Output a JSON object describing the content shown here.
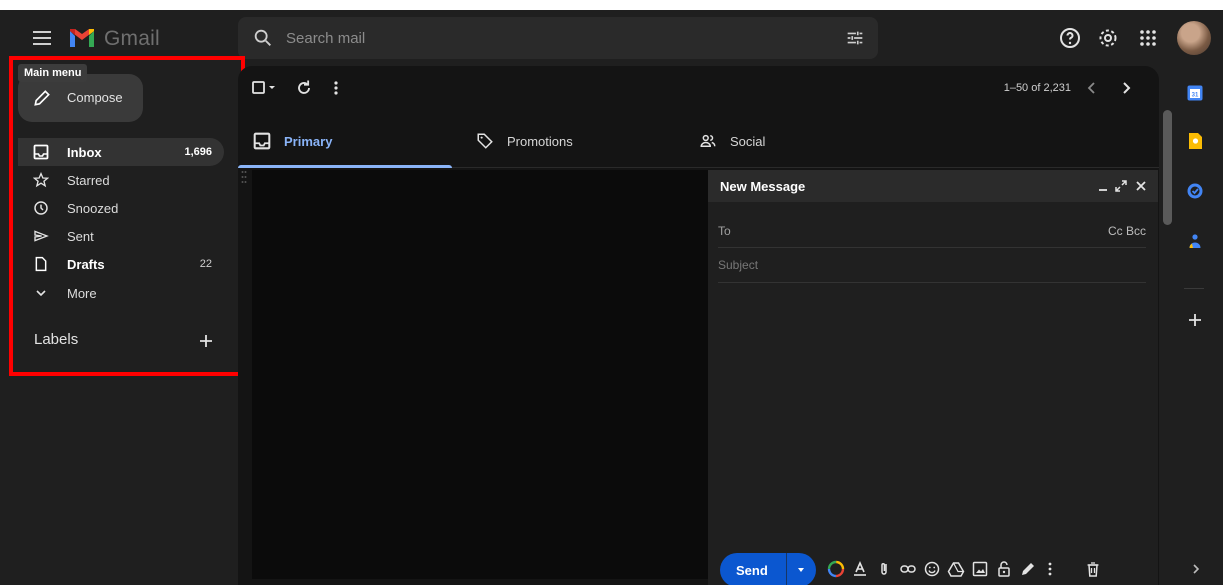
{
  "header": {
    "app_name": "Gmail",
    "search_placeholder": "Search mail"
  },
  "sidebar": {
    "tooltip": "Main menu",
    "compose_label": "Compose",
    "items": [
      {
        "label": "Inbox",
        "count": "1,696",
        "icon": "inbox-icon"
      },
      {
        "label": "Starred",
        "count": "",
        "icon": "star-icon"
      },
      {
        "label": "Snoozed",
        "count": "",
        "icon": "clock-icon"
      },
      {
        "label": "Sent",
        "count": "",
        "icon": "send-icon"
      },
      {
        "label": "Drafts",
        "count": "22",
        "icon": "draft-icon"
      },
      {
        "label": "More",
        "count": "",
        "icon": "chevron-down-icon"
      }
    ],
    "labels_title": "Labels"
  },
  "toolbar": {
    "range": "1–50 of 2,231"
  },
  "tabs": [
    {
      "label": "Primary",
      "icon": "inbox-icon"
    },
    {
      "label": "Promotions",
      "icon": "tag-icon"
    },
    {
      "label": "Social",
      "icon": "people-icon"
    }
  ],
  "compose_window": {
    "title": "New Message",
    "to_label": "To",
    "cc_bcc": "Cc Bcc",
    "subject_placeholder": "Subject",
    "send_label": "Send"
  },
  "colors": {
    "background": "#1f1f1f",
    "accent_blue": "#8ab4f8",
    "send_blue": "#0b57d0",
    "highlight_red": "#ff0000"
  }
}
